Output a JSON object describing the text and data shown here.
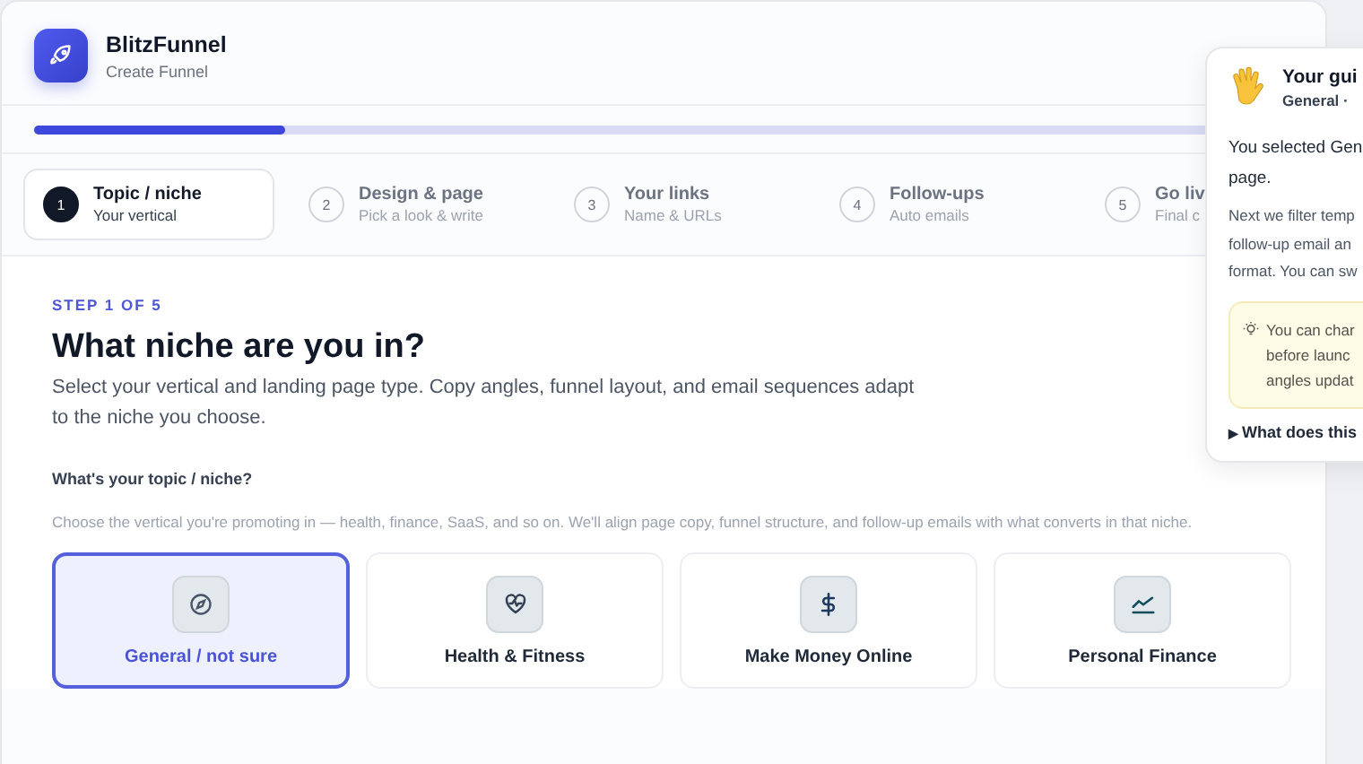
{
  "app": {
    "name": "BlitzFunnel",
    "subtitle": "Create Funnel"
  },
  "progress": {
    "level": 0.2
  },
  "steps": [
    {
      "number": "1",
      "title": "Topic / niche",
      "subtitle": "Your vertical",
      "selected": true
    },
    {
      "number": "2",
      "title": "Design & page",
      "subtitle": "Pick a look & write",
      "selected": false
    },
    {
      "number": "3",
      "title": "Your links",
      "subtitle": "Name & URLs",
      "selected": false
    },
    {
      "number": "4",
      "title": "Follow-ups",
      "subtitle": "Auto emails",
      "selected": false
    },
    {
      "number": "5",
      "title": "Go liv",
      "subtitle": "Final c",
      "selected": false
    }
  ],
  "content": {
    "eyebrow": "STEP 1 OF 5",
    "heading": "What niche are you in?",
    "intro": "Select your vertical and landing page type. Copy angles, funnel layout, and email sequences adapt to the niche you choose.",
    "question": "What's your topic / niche?",
    "hint": "Choose the vertical you're promoting in — health, finance, SaaS, and so on. We'll align page copy, funnel structure, and follow-up emails with what converts in that niche."
  },
  "niches": [
    {
      "kind": "compass",
      "label": "General / not sure",
      "selected": true
    },
    {
      "kind": "heart",
      "label": "Health & Fitness",
      "selected": false
    },
    {
      "kind": "dollar",
      "label": "Make Money Online",
      "selected": false
    },
    {
      "kind": "chart",
      "label": "Personal Finance",
      "selected": false
    }
  ],
  "guide": {
    "title": "Your gui",
    "subtitle": "General ·",
    "lead": [
      "You selected Gen",
      "page."
    ],
    "body": [
      "Next we filter temp",
      "follow-up email an",
      "format. You can sw"
    ],
    "tip": [
      "You can char",
      "before launc",
      "angles updat"
    ],
    "disclosure": "What does this",
    "disclosure_marker": "▶"
  }
}
